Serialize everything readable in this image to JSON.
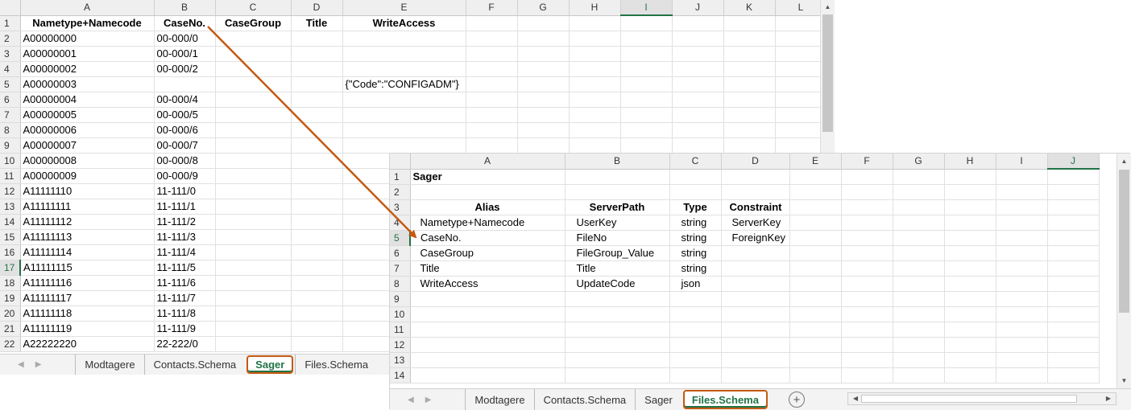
{
  "accent_color": "#217346",
  "highlight_color": "#c55a11",
  "sheet1": {
    "columns": [
      "A",
      "B",
      "C",
      "D",
      "E",
      "F",
      "G",
      "H",
      "I",
      "J",
      "K",
      "L"
    ],
    "selected_column": "I",
    "selected_row": "17",
    "headers": [
      "Nametype+Namecode",
      "CaseNo.",
      "CaseGroup",
      "Title",
      "WriteAccess"
    ],
    "rows": [
      {
        "num": "2",
        "a": "A00000000",
        "b": "00-000/0",
        "e": ""
      },
      {
        "num": "3",
        "a": "A00000001",
        "b": "00-000/1",
        "e": ""
      },
      {
        "num": "4",
        "a": "A00000002",
        "b": "00-000/2",
        "e": ""
      },
      {
        "num": "5",
        "a": "A00000003",
        "b": "",
        "e": "{\"Code\":\"CONFIGADM\"}"
      },
      {
        "num": "6",
        "a": "A00000004",
        "b": "00-000/4",
        "e": ""
      },
      {
        "num": "7",
        "a": "A00000005",
        "b": "00-000/5",
        "e": ""
      },
      {
        "num": "8",
        "a": "A00000006",
        "b": "00-000/6",
        "e": ""
      },
      {
        "num": "9",
        "a": "A00000007",
        "b": "00-000/7",
        "e": ""
      },
      {
        "num": "10",
        "a": "A00000008",
        "b": "00-000/8",
        "e": ""
      },
      {
        "num": "11",
        "a": "A00000009",
        "b": "00-000/9",
        "e": ""
      },
      {
        "num": "12",
        "a": "A11111110",
        "b": "11-111/0",
        "e": ""
      },
      {
        "num": "13",
        "a": "A11111111",
        "b": "11-111/1",
        "e": ""
      },
      {
        "num": "14",
        "a": "A11111112",
        "b": "11-111/2",
        "e": ""
      },
      {
        "num": "15",
        "a": "A11111113",
        "b": "11-111/3",
        "e": ""
      },
      {
        "num": "16",
        "a": "A11111114",
        "b": "11-111/4",
        "e": ""
      },
      {
        "num": "17",
        "a": "A11111115",
        "b": "11-111/5",
        "e": ""
      },
      {
        "num": "18",
        "a": "A11111116",
        "b": "11-111/6",
        "e": ""
      },
      {
        "num": "19",
        "a": "A11111117",
        "b": "11-111/7",
        "e": ""
      },
      {
        "num": "20",
        "a": "A11111118",
        "b": "11-111/8",
        "e": ""
      },
      {
        "num": "21",
        "a": "A11111119",
        "b": "11-111/9",
        "e": ""
      },
      {
        "num": "22",
        "a": "A22222220",
        "b": "22-222/0",
        "e": ""
      }
    ],
    "tabs": [
      "Modtagere",
      "Contacts.Schema",
      "Sager",
      "Files.Schema"
    ],
    "active_tab": "Sager"
  },
  "sheet2": {
    "columns": [
      "A",
      "B",
      "C",
      "D",
      "E",
      "F",
      "G",
      "H",
      "I",
      "J"
    ],
    "selected_column": "J",
    "selected_row": "5",
    "title": "Sager",
    "headers": [
      "Alias",
      "ServerPath",
      "Type",
      "Constraint"
    ],
    "rows": [
      {
        "num": "4",
        "alias": "Nametype+Namecode",
        "path": "UserKey",
        "type": "string",
        "constraint": "ServerKey"
      },
      {
        "num": "5",
        "alias": "CaseNo.",
        "path": "FileNo",
        "type": "string",
        "constraint": "ForeignKey"
      },
      {
        "num": "6",
        "alias": "CaseGroup",
        "path": "FileGroup_Value",
        "type": "string",
        "constraint": ""
      },
      {
        "num": "7",
        "alias": "Title",
        "path": "Title",
        "type": "string",
        "constraint": ""
      },
      {
        "num": "8",
        "alias": "WriteAccess",
        "path": "UpdateCode",
        "type": "json",
        "constraint": ""
      }
    ],
    "empty_rows": [
      "9",
      "10",
      "11",
      "12",
      "13",
      "14"
    ],
    "tabs": [
      "Modtagere",
      "Contacts.Schema",
      "Sager",
      "Files.Schema"
    ],
    "active_tab": "Files.Schema"
  }
}
